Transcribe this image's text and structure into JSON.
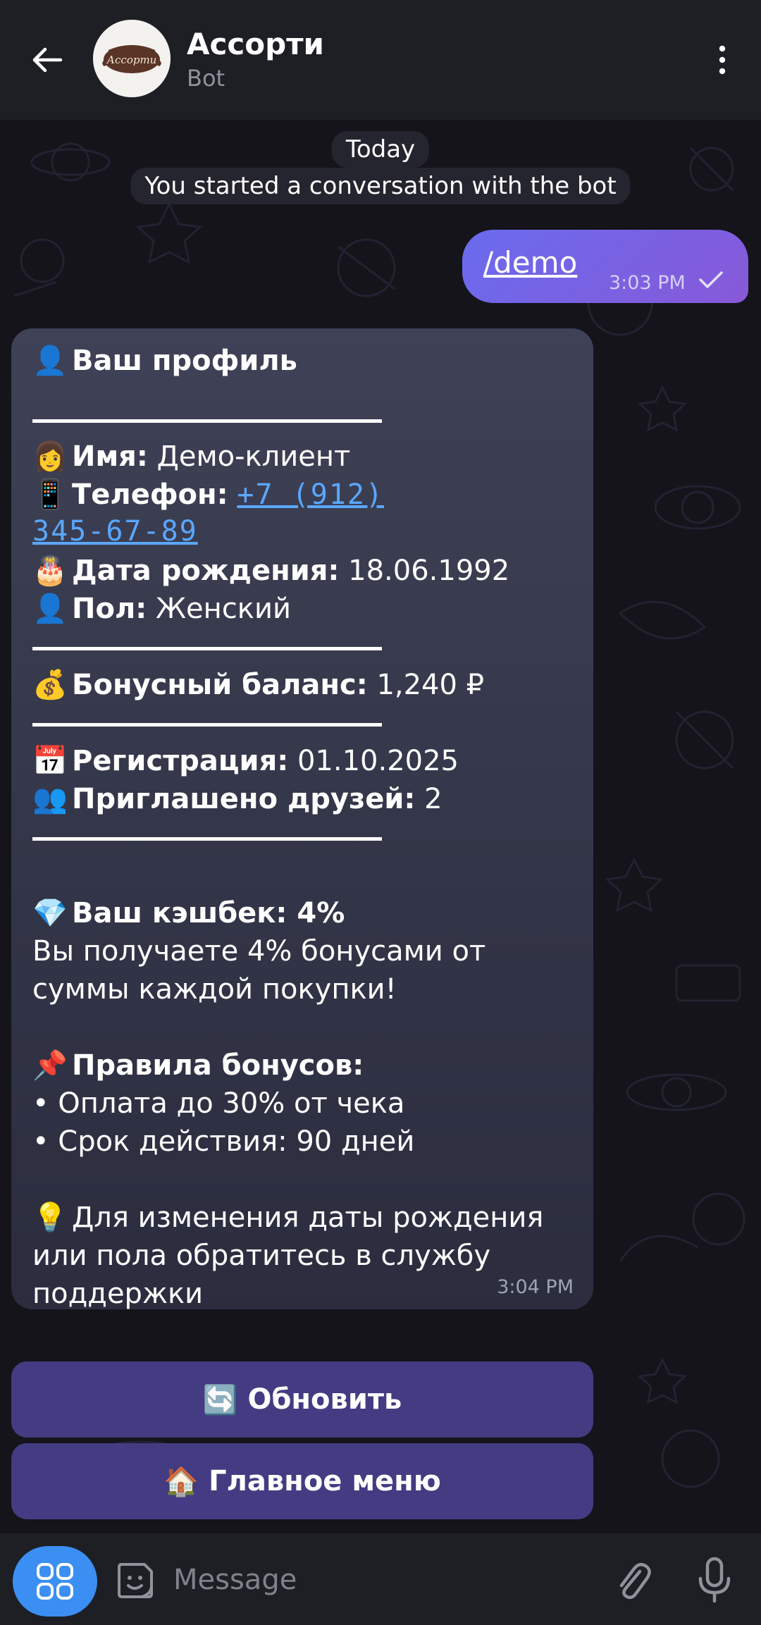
{
  "header": {
    "title": "Ассорти",
    "subtitle": "Bot",
    "avatar_text": "Ассорти"
  },
  "chat": {
    "date_chip": "Today",
    "service_message": "You started a conversation with the bot",
    "outgoing": {
      "text": "/demo",
      "time": "3:03 PM"
    },
    "incoming": {
      "title": "Ваш профиль",
      "name_label": "Имя:",
      "name_value": "Демо-клиент",
      "phone_label": "Телефон:",
      "phone_line1": "+7 (912)",
      "phone_line2": "345-67-89",
      "birthday_label": "Дата рождения:",
      "birthday_value": "18.06.1992",
      "gender_label": "Пол:",
      "gender_value": "Женский",
      "balance_label": "Бонусный баланс:",
      "balance_value": "1,240 ₽",
      "registration_label": "Регистрация:",
      "registration_value": "01.10.2025",
      "invited_label": "Приглашено друзей:",
      "invited_value": "2",
      "cashback_title": "Ваш кэшбек: 4%",
      "cashback_line1": "Вы получаете 4% бонусами от",
      "cashback_line2": "суммы каждой покупки!",
      "rules_title": "Правила бонусов:",
      "rule1": "• Оплата до 30% от чека",
      "rule2": "• Срок действия: 90 дней",
      "note_line1": "Для изменения даты рождения",
      "note_line2": "или пола обратитесь в службу",
      "note_line3": "поддержки",
      "time": "3:04 PM"
    },
    "buttons": {
      "refresh": "Обновить",
      "main_menu": "Главное меню"
    }
  },
  "input": {
    "placeholder": "Message"
  },
  "emoji": {
    "profile": "👤",
    "name": "👩",
    "phone": "📱",
    "birthday": "🎂",
    "gender": "👤",
    "balance": "💰",
    "registration": "📅",
    "invited": "👥",
    "cashback": "💎",
    "rules": "📌",
    "note": "💡",
    "refresh": "🔄",
    "home": "🏠"
  },
  "colors": {
    "accent": "#3b8ff2",
    "outgoing_bubble": "#7663e6",
    "incoming_bubble": "#383a4e",
    "keyboard_button": "#433c82",
    "link": "#5aa7ff"
  }
}
